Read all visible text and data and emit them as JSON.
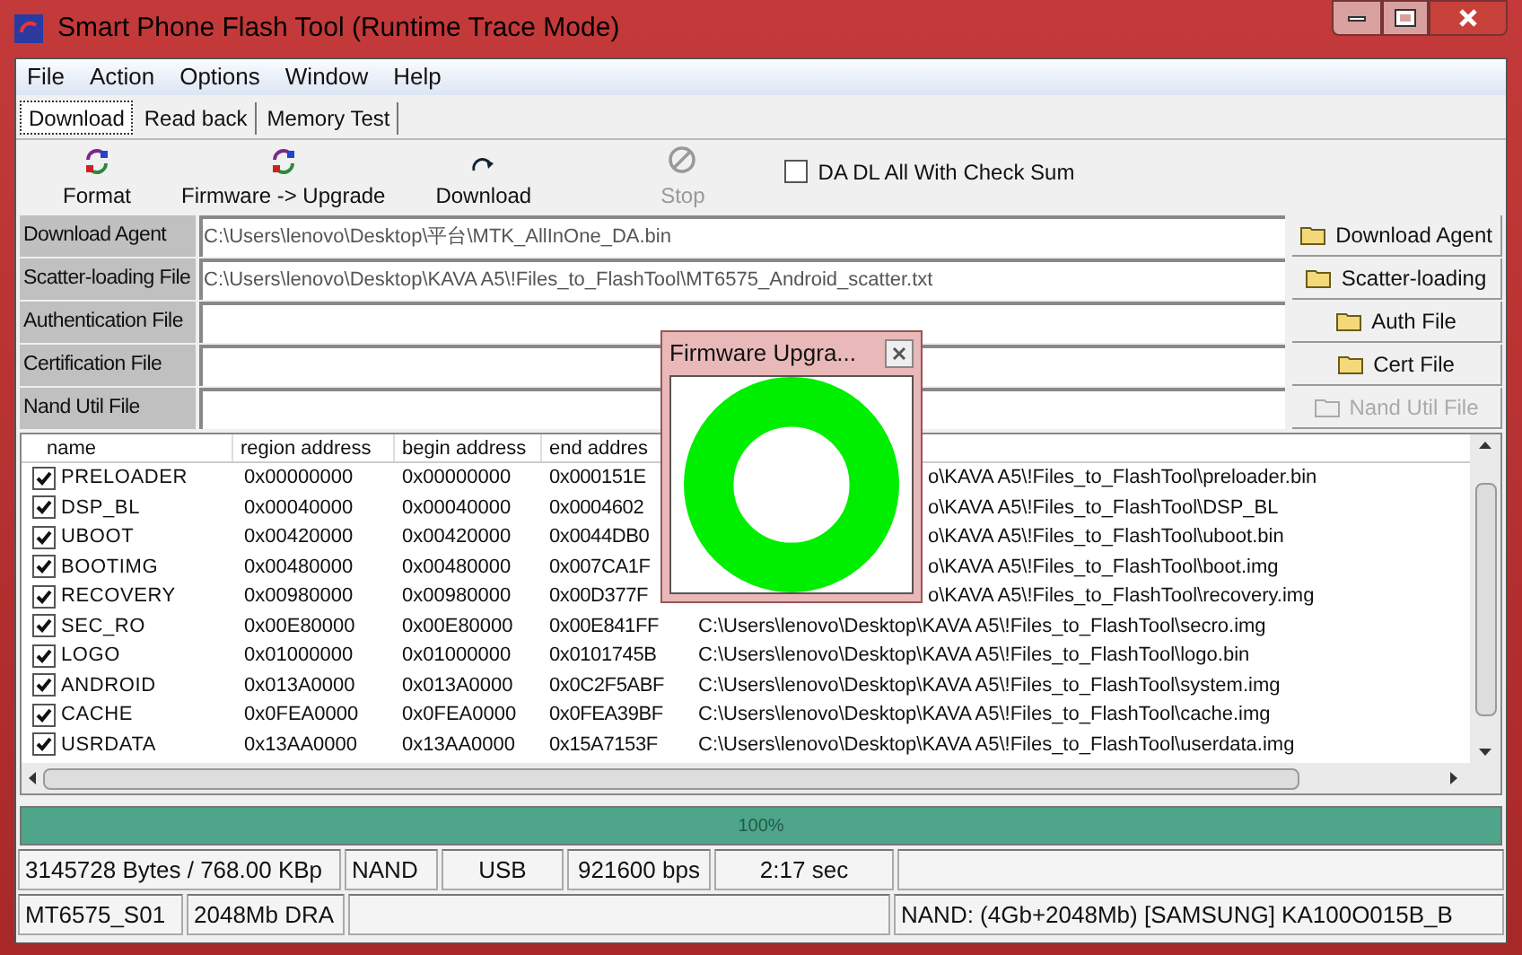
{
  "window": {
    "title": "Smart Phone Flash Tool (Runtime Trace Mode)"
  },
  "menu": [
    "File",
    "Action",
    "Options",
    "Window",
    "Help"
  ],
  "tabs": [
    {
      "label": "Download",
      "selected": true
    },
    {
      "label": "Read back",
      "selected": false
    },
    {
      "label": "Memory Test",
      "selected": false
    }
  ],
  "toolbar": [
    {
      "label": "Format",
      "kind": "format",
      "disabled": false
    },
    {
      "label": "Firmware -> Upgrade",
      "kind": "format",
      "disabled": false
    },
    {
      "label": "Download",
      "kind": "download",
      "disabled": false
    },
    {
      "label": "Stop",
      "kind": "stop",
      "disabled": true
    }
  ],
  "checksum": {
    "label": "DA DL All With Check Sum",
    "checked": false
  },
  "files": [
    {
      "label": "Download Agent",
      "value": "C:\\Users\\lenovo\\Desktop\\平台\\MTK_AllInOne_DA.bin",
      "button": "Download Agent",
      "disabled": false
    },
    {
      "label": "Scatter-loading File",
      "value": "C:\\Users\\lenovo\\Desktop\\KAVA A5\\!Files_to_FlashTool\\MT6575_Android_scatter.txt",
      "button": "Scatter-loading",
      "disabled": false
    },
    {
      "label": "Authentication File",
      "button": "Auth File",
      "disabled": false
    },
    {
      "label": "Certification File",
      "button": "Cert File",
      "disabled": false
    },
    {
      "label": "Nand Util File",
      "button": "Nand Util File",
      "disabled": true
    }
  ],
  "table": {
    "columns": [
      "name",
      "region address",
      "begin address",
      "end addres"
    ],
    "rows": [
      {
        "checked": true,
        "name": "PRELOADER",
        "region": "0x00000000",
        "begin": "0x00000000",
        "end": "0x000151E",
        "path": "o\\KAVA A5\\!Files_to_FlashTool\\preloader.bin"
      },
      {
        "checked": true,
        "name": "DSP_BL",
        "region": "0x00040000",
        "begin": "0x00040000",
        "end": "0x0004602",
        "path": "o\\KAVA A5\\!Files_to_FlashTool\\DSP_BL"
      },
      {
        "checked": true,
        "name": "UBOOT",
        "region": "0x00420000",
        "begin": "0x00420000",
        "end": "0x0044DB0",
        "path": "o\\KAVA A5\\!Files_to_FlashTool\\uboot.bin"
      },
      {
        "checked": true,
        "name": "BOOTIMG",
        "region": "0x00480000",
        "begin": "0x00480000",
        "end": "0x007CA1F",
        "path": "o\\KAVA A5\\!Files_to_FlashTool\\boot.img"
      },
      {
        "checked": true,
        "name": "RECOVERY",
        "region": "0x00980000",
        "begin": "0x00980000",
        "end": "0x00D377F",
        "path": "o\\KAVA A5\\!Files_to_FlashTool\\recovery.img"
      },
      {
        "checked": true,
        "name": "SEC_RO",
        "region": "0x00E80000",
        "begin": "0x00E80000",
        "end": "0x00E841FF",
        "path": "C:\\Users\\lenovo\\Desktop\\KAVA A5\\!Files_to_FlashTool\\secro.img"
      },
      {
        "checked": true,
        "name": "LOGO",
        "region": "0x01000000",
        "begin": "0x01000000",
        "end": "0x0101745B",
        "path": "C:\\Users\\lenovo\\Desktop\\KAVA A5\\!Files_to_FlashTool\\logo.bin"
      },
      {
        "checked": true,
        "name": "ANDROID",
        "region": "0x013A0000",
        "begin": "0x013A0000",
        "end": "0x0C2F5ABF",
        "path": "C:\\Users\\lenovo\\Desktop\\KAVA A5\\!Files_to_FlashTool\\system.img"
      },
      {
        "checked": true,
        "name": "CACHE",
        "region": "0x0FEA0000",
        "begin": "0x0FEA0000",
        "end": "0x0FEA39BF",
        "path": "C:\\Users\\lenovo\\Desktop\\KAVA A5\\!Files_to_FlashTool\\cache.img"
      },
      {
        "checked": true,
        "name": "USRDATA",
        "region": "0x13AA0000",
        "begin": "0x13AA0000",
        "end": "0x15A7153F",
        "path": "C:\\Users\\lenovo\\Desktop\\KAVA A5\\!Files_to_FlashTool\\userdata.img"
      }
    ]
  },
  "popup": {
    "title": "Firmware Upgra..."
  },
  "progress": {
    "label": "100%",
    "level": 1
  },
  "status_rows": [
    [
      "3145728 Bytes / 768.00 KBp",
      "NAND",
      "USB",
      "921600 bps",
      "2:17 sec",
      ""
    ],
    [
      "MT6575_S01",
      "2048Mb DRA",
      "",
      "NAND: (4Gb+2048Mb) [SAMSUNG] KA100O015B_B"
    ]
  ]
}
